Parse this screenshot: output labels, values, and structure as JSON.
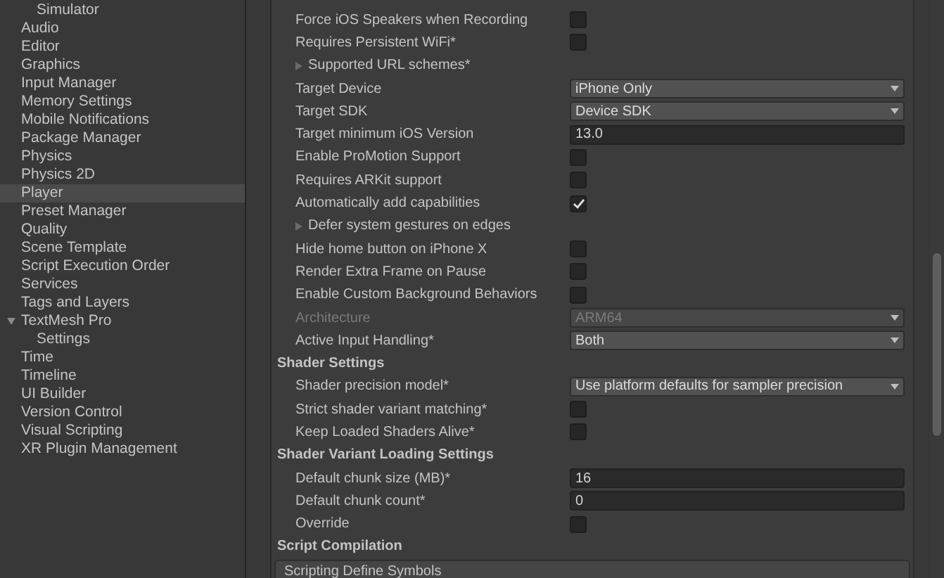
{
  "sidebar": {
    "items": [
      {
        "children": [
          {
            "label": "Simulator",
            "selected": false
          }
        ]
      },
      {
        "label": "Audio",
        "selected": false
      },
      {
        "label": "Editor",
        "selected": false
      },
      {
        "label": "Graphics",
        "selected": false
      },
      {
        "label": "Input Manager",
        "selected": false
      },
      {
        "label": "Memory Settings",
        "selected": false
      },
      {
        "label": "Mobile Notifications",
        "selected": false
      },
      {
        "label": "Package Manager",
        "selected": false
      },
      {
        "label": "Physics",
        "selected": false
      },
      {
        "label": "Physics 2D",
        "selected": false
      },
      {
        "label": "Player",
        "selected": true
      },
      {
        "label": "Preset Manager",
        "selected": false
      },
      {
        "label": "Quality",
        "selected": false
      },
      {
        "label": "Scene Template",
        "selected": false
      },
      {
        "label": "Script Execution Order",
        "selected": false
      },
      {
        "label": "Services",
        "selected": false
      },
      {
        "label": "Tags and Layers",
        "selected": false
      },
      {
        "label": "TextMesh Pro",
        "selected": false,
        "expanded": true,
        "children": [
          {
            "label": "Settings",
            "selected": false
          }
        ]
      },
      {
        "label": "Time",
        "selected": false
      },
      {
        "label": "Timeline",
        "selected": false
      },
      {
        "label": "UI Builder",
        "selected": false
      },
      {
        "label": "Version Control",
        "selected": false
      },
      {
        "label": "Visual Scripting",
        "selected": false
      },
      {
        "label": "XR Plugin Management",
        "selected": false
      }
    ]
  },
  "settings": {
    "rows": [
      {
        "kind": "checkbox",
        "label": "Force iOS Speakers when Recording",
        "checked": false
      },
      {
        "kind": "checkbox",
        "label": "Requires Persistent WiFi*",
        "checked": false
      },
      {
        "kind": "foldout",
        "label": "Supported URL schemes*",
        "expanded": false
      },
      {
        "kind": "dropdown",
        "label": "Target Device",
        "value": "iPhone Only",
        "disabled": false
      },
      {
        "kind": "dropdown",
        "label": "Target SDK",
        "value": "Device SDK",
        "disabled": false
      },
      {
        "kind": "text",
        "label": "Target minimum iOS Version",
        "value": "13.0"
      },
      {
        "kind": "checkbox",
        "label": "Enable ProMotion Support",
        "checked": false
      },
      {
        "kind": "checkbox",
        "label": "Requires ARKit support",
        "checked": false
      },
      {
        "kind": "checkbox",
        "label": "Automatically add capabilities",
        "checked": true
      },
      {
        "kind": "foldout",
        "label": "Defer system gestures on edges",
        "expanded": false
      },
      {
        "kind": "checkbox",
        "label": "Hide home button on iPhone X",
        "checked": false
      },
      {
        "kind": "checkbox",
        "label": "Render Extra Frame on Pause",
        "checked": false
      },
      {
        "kind": "checkbox",
        "label": "Enable Custom Background Behaviors",
        "checked": false
      },
      {
        "kind": "dropdown",
        "label": "Architecture",
        "value": "ARM64",
        "disabled": true
      },
      {
        "kind": "dropdown",
        "label": "Active Input Handling*",
        "value": "Both",
        "disabled": false
      },
      {
        "kind": "header",
        "label": "Shader Settings"
      },
      {
        "kind": "dropdown",
        "label": "Shader precision model*",
        "value": "Use platform defaults for sampler precision",
        "disabled": false
      },
      {
        "kind": "checkbox",
        "label": "Strict shader variant matching*",
        "checked": false
      },
      {
        "kind": "checkbox",
        "label": "Keep Loaded Shaders Alive*",
        "checked": false
      },
      {
        "kind": "header",
        "label": "Shader Variant Loading Settings"
      },
      {
        "kind": "text",
        "label": "Default chunk size (MB)*",
        "value": "16"
      },
      {
        "kind": "text",
        "label": "Default chunk count*",
        "value": "0"
      },
      {
        "kind": "checkbox",
        "label": "Override",
        "checked": false
      },
      {
        "kind": "header",
        "label": "Script Compilation"
      },
      {
        "kind": "box",
        "label": "Scripting Define Symbols"
      }
    ]
  }
}
